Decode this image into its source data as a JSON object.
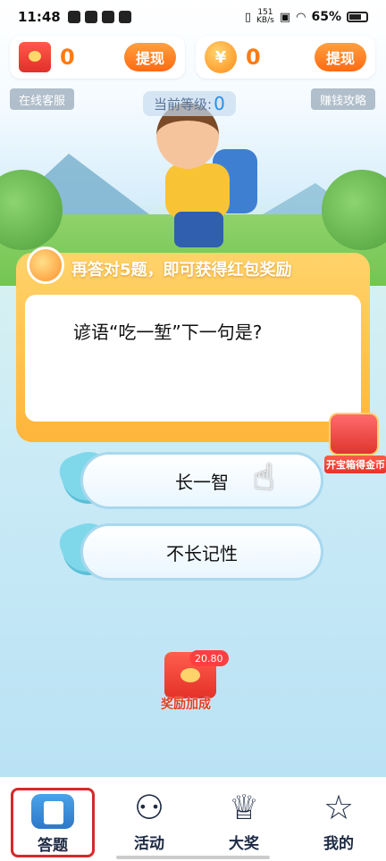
{
  "status_bar": {
    "time": "11:48",
    "speed_value": "151",
    "speed_unit": "KB/s",
    "battery": "65%"
  },
  "balances": {
    "redpack": {
      "value": "0",
      "withdraw_label": "提现"
    },
    "coins": {
      "value": "0",
      "withdraw_label": "提现",
      "icon_glyph": "¥"
    }
  },
  "top_links": {
    "service": "在线客服",
    "strategy": "赚钱攻略"
  },
  "level": {
    "label": "当前等级:",
    "value": "0"
  },
  "question": {
    "promo": "再答对5题，即可获得红包奖励",
    "text": "谚语“吃一堑”下一句是?"
  },
  "treasure": {
    "label": "开宝箱得金币"
  },
  "answers": [
    {
      "label": "长一智"
    },
    {
      "label": "不长记性"
    }
  ],
  "reward_bonus": {
    "badge": "20.80",
    "label": "奖励加成"
  },
  "nav": [
    {
      "label": "答题",
      "icon": "book-icon",
      "active": true
    },
    {
      "label": "活动",
      "icon": "balloons-icon"
    },
    {
      "label": "大奖",
      "icon": "trophy-icon"
    },
    {
      "label": "我的",
      "icon": "star-face-icon"
    }
  ],
  "colors": {
    "accent": "#ff7b14",
    "nav_text": "#1d2a44",
    "active_outline": "#d52a2a"
  }
}
